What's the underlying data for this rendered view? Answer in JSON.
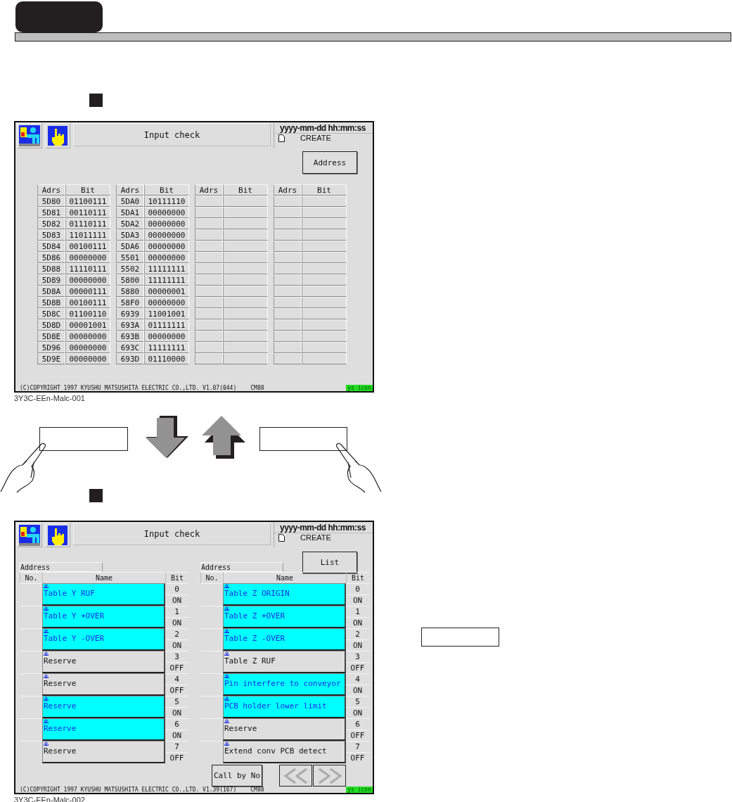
{
  "screens": [
    {
      "kind": "list",
      "title": "Input check",
      "datetime": "yyyy-mm-dd  hh:mm:ss",
      "mode": "CREATE",
      "button": "Address",
      "tables": [
        {
          "headers": [
            "Adrs",
            "Bit"
          ],
          "rows": [
            {
              "adrs": "5D80",
              "bit": "01100111"
            },
            {
              "adrs": "5D81",
              "bit": "00110111"
            },
            {
              "adrs": "5D82",
              "bit": "01110111"
            },
            {
              "adrs": "5D83",
              "bit": "11011111"
            },
            {
              "adrs": "5D84",
              "bit": "00100111"
            },
            {
              "adrs": "5D86",
              "bit": "00000000"
            },
            {
              "adrs": "5D88",
              "bit": "11110111"
            },
            {
              "adrs": "5D89",
              "bit": "00000000"
            },
            {
              "adrs": "5D8A",
              "bit": "00000111"
            },
            {
              "adrs": "5D8B",
              "bit": "00100111"
            },
            {
              "adrs": "5D8C",
              "bit": "01100110"
            },
            {
              "adrs": "5D8D",
              "bit": "00001001"
            },
            {
              "adrs": "5D8E",
              "bit": "00000000"
            },
            {
              "adrs": "5D96",
              "bit": "00000000"
            },
            {
              "adrs": "5D9E",
              "bit": "00000000"
            }
          ]
        },
        {
          "headers": [
            "Adrs",
            "Bit"
          ],
          "rows": [
            {
              "adrs": "5DA0",
              "bit": "10111110"
            },
            {
              "adrs": "5DA1",
              "bit": "00000000"
            },
            {
              "adrs": "5DA2",
              "bit": "00000000"
            },
            {
              "adrs": "5DA3",
              "bit": "00000000"
            },
            {
              "adrs": "5DA6",
              "bit": "00000000"
            },
            {
              "adrs": "5501",
              "bit": "00000000"
            },
            {
              "adrs": "5502",
              "bit": "11111111"
            },
            {
              "adrs": "5800",
              "bit": "11111111"
            },
            {
              "adrs": "5880",
              "bit": "00000001"
            },
            {
              "adrs": "58F0",
              "bit": "00000000"
            },
            {
              "adrs": "6939",
              "bit": "11001001"
            },
            {
              "adrs": "693A",
              "bit": "01111111"
            },
            {
              "adrs": "693B",
              "bit": "00000000"
            },
            {
              "adrs": "693C",
              "bit": "11111111"
            },
            {
              "adrs": "693D",
              "bit": "01110000"
            }
          ]
        },
        {
          "headers": [
            "Adrs",
            "Bit"
          ]
        },
        {
          "headers": [
            "Adrs",
            "Bit"
          ]
        }
      ],
      "footer": {
        "copyright": "(C)COPYRIGHT 1997 KYUSHU MATSUSHITA ELECTRIC CO.,LTD.  V1.07(044)",
        "model": "CM88",
        "badge": "ys icon"
      },
      "caption": "3Y3C-EEn-Malc-001"
    },
    {
      "kind": "detail",
      "title": "Input check",
      "datetime": "yyyy-mm-dd  hh:mm:ss",
      "mode": "CREATE",
      "button": "List",
      "panels": [
        {
          "label": "Address",
          "headers": [
            "No.",
            "Name",
            "Bit"
          ],
          "rows": [
            {
              "name": "Table Y RUF",
              "bit": "0",
              "state": "ON",
              "on": true
            },
            {
              "name": "Table Y +OVER",
              "bit": "1",
              "state": "ON",
              "on": true
            },
            {
              "name": "Table Y -OVER",
              "bit": "2",
              "state": "ON",
              "on": true
            },
            {
              "name": "Reserve",
              "bit": "3",
              "state": "OFF",
              "on": false
            },
            {
              "name": "Reserve",
              "bit": "4",
              "state": "OFF",
              "on": false
            },
            {
              "name": "Reserve",
              "bit": "5",
              "state": "ON",
              "on": true
            },
            {
              "name": "Reserve",
              "bit": "6",
              "state": "ON",
              "on": true
            },
            {
              "name": "Reserve",
              "bit": "7",
              "state": "OFF",
              "on": false
            }
          ]
        },
        {
          "label": "Address",
          "headers": [
            "No.",
            "Name",
            "Bit"
          ],
          "rows": [
            {
              "name": "Table Z ORIGIN",
              "bit": "0",
              "state": "ON",
              "on": true
            },
            {
              "name": "Table Z +OVER",
              "bit": "1",
              "state": "ON",
              "on": true
            },
            {
              "name": "Table Z -OVER",
              "bit": "2",
              "state": "ON",
              "on": true
            },
            {
              "name": "Table Z RUF",
              "bit": "3",
              "state": "OFF",
              "on": false
            },
            {
              "name": "Pin interfere to conveyor",
              "bit": "4",
              "state": "ON",
              "on": true
            },
            {
              "name": "PCB holder lower limit",
              "bit": "5",
              "state": "ON",
              "on": true
            },
            {
              "name": "Reserve",
              "bit": "6",
              "state": "OFF",
              "on": false
            },
            {
              "name": "Extend conv PCB detect",
              "bit": "7",
              "state": "OFF",
              "on": false
            }
          ]
        }
      ],
      "call_button": "Call by No",
      "footer": {
        "copyright": "(C)COPYRIGHT 1997 KYUSHU MATSUSHITA ELECTRIC CO.,LTD.  V1.39(167)",
        "model": "CM88",
        "badge": "ys icon"
      },
      "caption": "3Y3C-EEn-Malc-002"
    }
  ]
}
